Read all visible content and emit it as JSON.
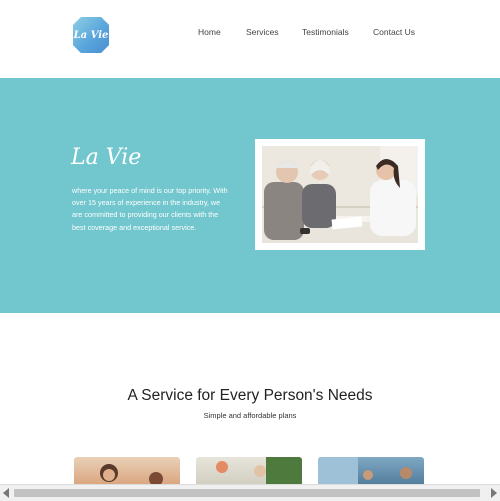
{
  "brand": {
    "logo_text": "La Vie"
  },
  "nav": {
    "items": [
      {
        "label": "Home"
      },
      {
        "label": "Services"
      },
      {
        "label": "Testimonials"
      },
      {
        "label": "Contact Us"
      }
    ]
  },
  "hero": {
    "title": "La Vie",
    "text": "where your peace of mind is our top priority. With over 15 years of experience in the industry, we are committed to providing our clients with the best coverage and exceptional service.",
    "background_color": "#72c6cd"
  },
  "services": {
    "title": "A Service for Every Person's Needs",
    "subtitle": "Simple and affordable plans"
  }
}
